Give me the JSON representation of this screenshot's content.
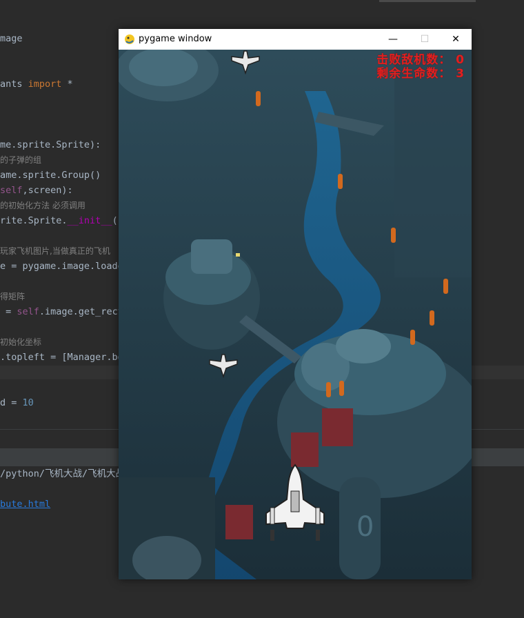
{
  "editor": {
    "lines": [
      {
        "segs": [
          [
            "",
            "mage"
          ]
        ]
      },
      {
        "segs": [
          [
            "",
            "ants "
          ],
          [
            "kw",
            "import"
          ],
          [
            "",
            " *"
          ]
        ]
      },
      {
        "segs": [
          [
            "",
            "me.sprite.Sprite):"
          ]
        ]
      },
      {
        "segs": [
          [
            "cmt",
            "的子弹的组"
          ]
        ]
      },
      {
        "segs": [
          [
            "",
            "ame.sprite.Group()"
          ]
        ]
      },
      {
        "segs": [
          [
            "self",
            "self"
          ],
          [
            "",
            ",screen):"
          ]
        ]
      },
      {
        "segs": [
          [
            "cmt",
            "的初始化方法 必须调用"
          ]
        ]
      },
      {
        "segs": [
          [
            "",
            "rite.Sprite."
          ],
          [
            "dunder",
            "__init__"
          ],
          [
            "",
            "(s"
          ]
        ]
      },
      {
        "segs": [
          [
            "cmt",
            "玩家飞机图片,当做真正的飞机"
          ]
        ]
      },
      {
        "segs": [
          [
            "",
            "e = pygame.image.loade"
          ]
        ]
      },
      {
        "segs": [
          [
            "cmt",
            "得矩阵"
          ]
        ]
      },
      {
        "segs": [
          [
            "",
            " = "
          ],
          [
            "self",
            "self"
          ],
          [
            "",
            ".image.get_rect"
          ]
        ]
      },
      {
        "segs": [
          [
            "cmt",
            "初始化坐标"
          ]
        ]
      },
      {
        "segs": [
          [
            "",
            ".topleft = [Manager.bg"
          ]
        ]
      },
      {
        "segs": [
          [
            "",
            "d = "
          ],
          [
            "num",
            "10"
          ]
        ]
      },
      {
        "segs": [
          [
            "",
            "/python/飞机大战/飞机大战"
          ]
        ]
      },
      {
        "segs": [
          [
            "link",
            "bute.html"
          ]
        ]
      }
    ]
  },
  "window": {
    "title": "pygame window",
    "minimize_glyph": "—",
    "maximize_glyph": "☐",
    "close_glyph": "✕"
  },
  "hud": {
    "kills_text": "击败敌机数： 0",
    "lives_text": "剩余生命数： 3"
  },
  "colors": {
    "hud": "#e02020",
    "bullet": "#d2691e",
    "player": "#f2f2f2"
  },
  "icons": {
    "window_icon": "pygame-snake-icon",
    "player": "player-jet-icon",
    "enemy": "enemy-plane-icon"
  },
  "enemies": {
    "count": 2
  },
  "bullets": {
    "count": 8
  }
}
